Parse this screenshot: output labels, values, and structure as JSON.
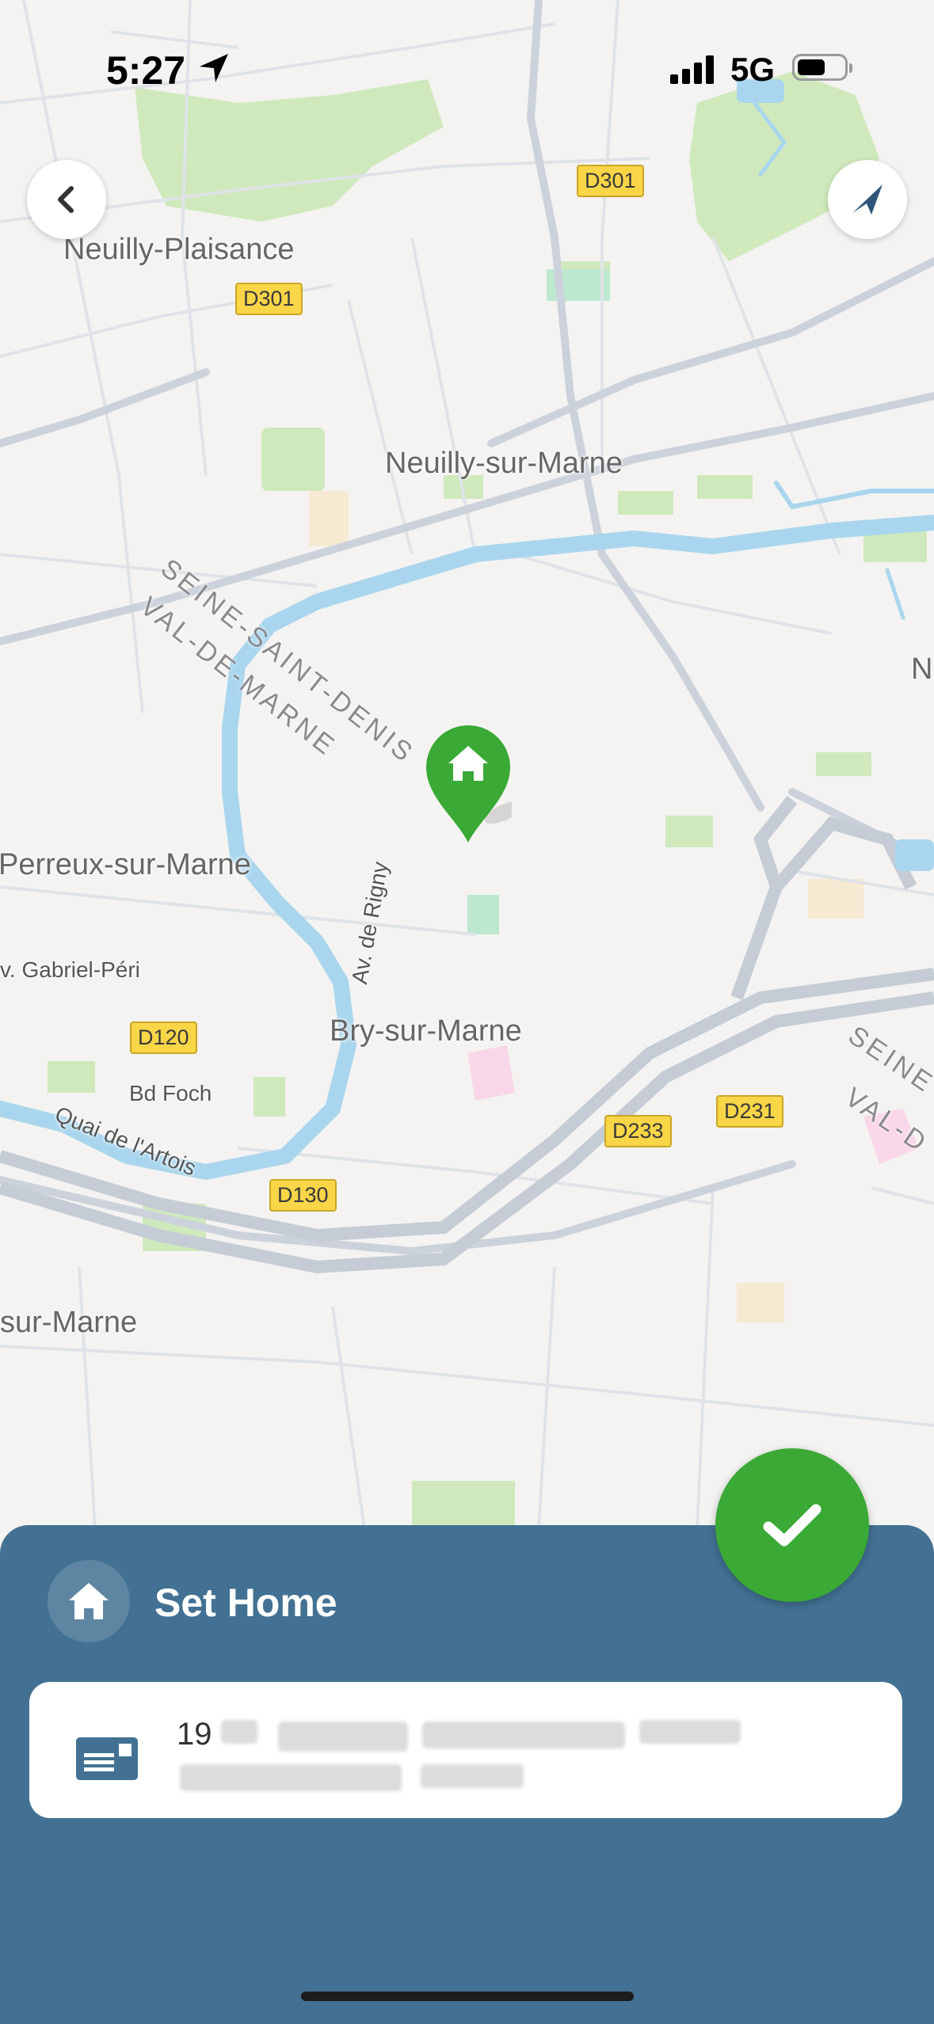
{
  "status_bar": {
    "time": "5:27",
    "network": "5G"
  },
  "map": {
    "places": [
      "Neuilly-Plaisance",
      "Neuilly-sur-Marne",
      "Perreux-sur-Marne",
      "Bry-sur-Marne",
      "sur-Marne",
      "N"
    ],
    "regions": [
      "SEINE-SAINT-DENIS",
      "VAL-DE-MARNE",
      "SEINE",
      "VAL-D"
    ],
    "streets": [
      "Av. de Rigny",
      "v. Gabriel-Péri",
      "Bd Foch",
      "Quai de l'Artois"
    ],
    "road_shields": [
      "D301",
      "D301",
      "D120",
      "D130",
      "D233",
      "D231"
    ],
    "icons": {
      "back": "chevron-left-icon",
      "locate": "navigation-arrow-icon",
      "pin": "home-pin-icon"
    },
    "colors": {
      "water": "#a9d6ee",
      "park": "#cfe9bd",
      "road": "#ccd2db"
    }
  },
  "sheet": {
    "title": "Set Home",
    "address_number": "19",
    "confirm_icon": "checkmark-icon",
    "colors": {
      "sheet": "#427193",
      "confirm": "#3aa935"
    }
  }
}
